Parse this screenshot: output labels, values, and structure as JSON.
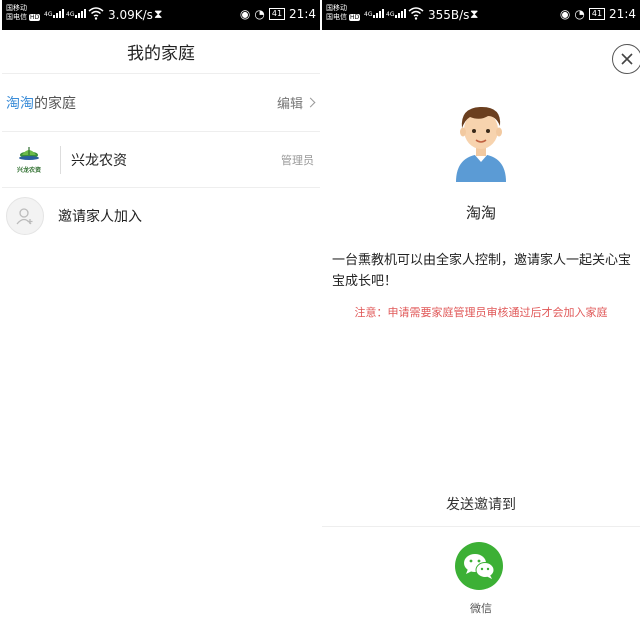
{
  "status_left": {
    "carrier1": "国移动",
    "carrier2": "国电信",
    "hd": "HD",
    "net1": "4G",
    "net2": "4G",
    "speed": "3.09K/s",
    "battery": "41",
    "time": "21:4"
  },
  "status_right": {
    "carrier1": "国移动",
    "carrier2": "国电信",
    "hd": "HD",
    "net1": "4G",
    "net2": "4G",
    "speed": "355B/s",
    "battery": "41",
    "time": "21:4"
  },
  "left": {
    "title": "我的家庭",
    "family": {
      "owner": "淘淘",
      "suffix": "的家庭",
      "edit_label": "编辑"
    },
    "member": {
      "logo_text": "兴龙农资",
      "name": "兴龙农资",
      "role": "管理员"
    },
    "invite_label": "邀请家人加入"
  },
  "right": {
    "username": "淘淘",
    "description": "一台熏教机可以由全家人控制，邀请家人一起关心宝宝成长吧！",
    "notice": "注意：申请需要家庭管理员审核通过后才会加入家庭",
    "send_to_label": "发送邀请到",
    "wechat_label": "微信"
  },
  "colors": {
    "accent_blue": "#3a8cd8",
    "notice_red": "#e05858",
    "wechat_green": "#3cb035"
  }
}
